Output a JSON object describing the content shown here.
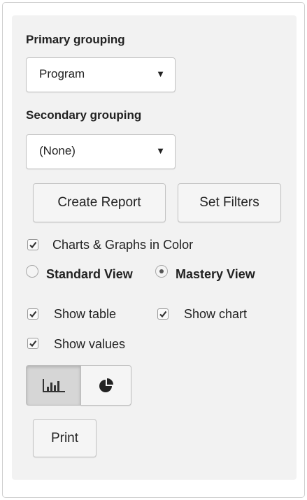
{
  "primary": {
    "label": "Primary grouping",
    "value": "Program",
    "arrow": "▼"
  },
  "secondary": {
    "label": "Secondary grouping",
    "value": "(None)",
    "arrow": "▼"
  },
  "buttons": {
    "create_report": "Create Report",
    "set_filters": "Set Filters",
    "print": "Print"
  },
  "options": {
    "color": {
      "label": "Charts & Graphs in Color",
      "checked": true
    },
    "view": {
      "standard": {
        "label": "Standard View",
        "selected": false
      },
      "mastery": {
        "label": "Mastery View",
        "selected": true
      }
    },
    "show_table": {
      "label": "Show table",
      "checked": true
    },
    "show_chart": {
      "label": "Show chart",
      "checked": true
    },
    "show_values": {
      "label": "Show values",
      "checked": true
    }
  },
  "chart_type": {
    "selected": "bar",
    "options": [
      "bar-chart-icon",
      "pie-chart-icon"
    ]
  }
}
